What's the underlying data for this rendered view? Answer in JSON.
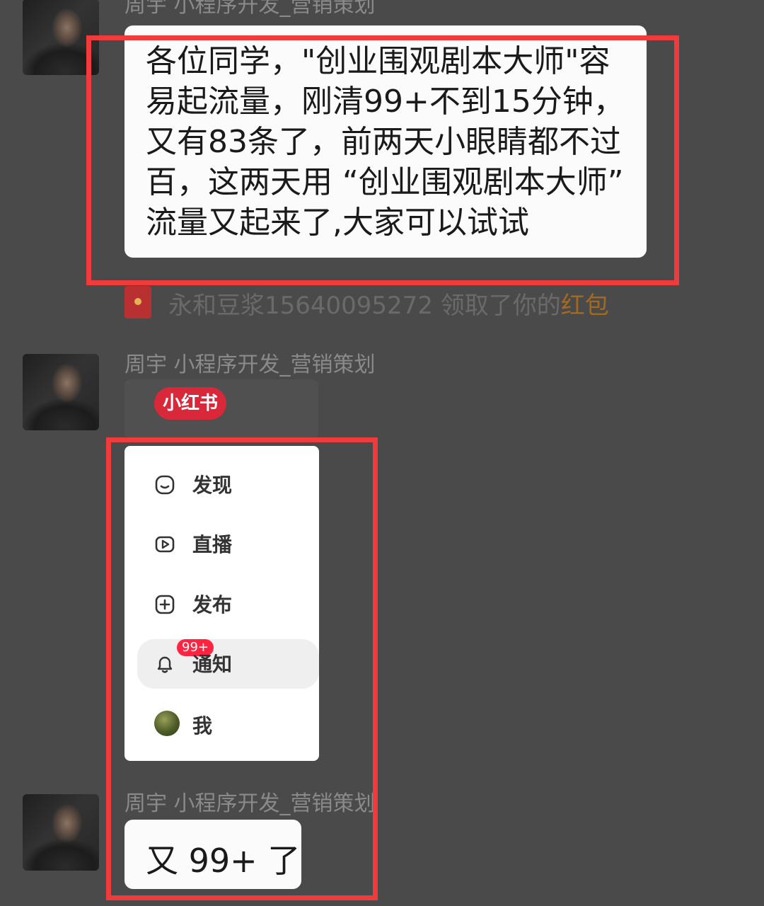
{
  "messages": {
    "first": {
      "sender": "周宇 小程序开发_营销策划",
      "text": "各位同学，\"创业围观剧本大师\"容易起流量，刚清99+不到15分钟，又有83条了，前两天小眼睛都不过百，这两天用 “创业围观剧本大师” 流量又起来了,大家可以试试"
    },
    "red_packet": {
      "text": "永和豆浆15640095272 领取了你的",
      "link": "红包"
    },
    "second": {
      "sender": "周宇 小程序开发_营销策划",
      "app_logo": "小红书",
      "menu": [
        {
          "label": "发现",
          "icon": "discover-icon"
        },
        {
          "label": "直播",
          "icon": "live-icon"
        },
        {
          "label": "发布",
          "icon": "publish-icon"
        },
        {
          "label": "通知",
          "icon": "bell-icon",
          "badge": "99+"
        },
        {
          "label": "我",
          "icon": "user-avatar-icon"
        }
      ]
    },
    "third": {
      "sender": "周宇 小程序开发_营销策划",
      "text": "又 99+ 了"
    }
  },
  "colors": {
    "background": "#4a4a4a",
    "highlight_border": "#ef3b3b",
    "badge": "#ff2442",
    "brand": "#d8283a"
  }
}
